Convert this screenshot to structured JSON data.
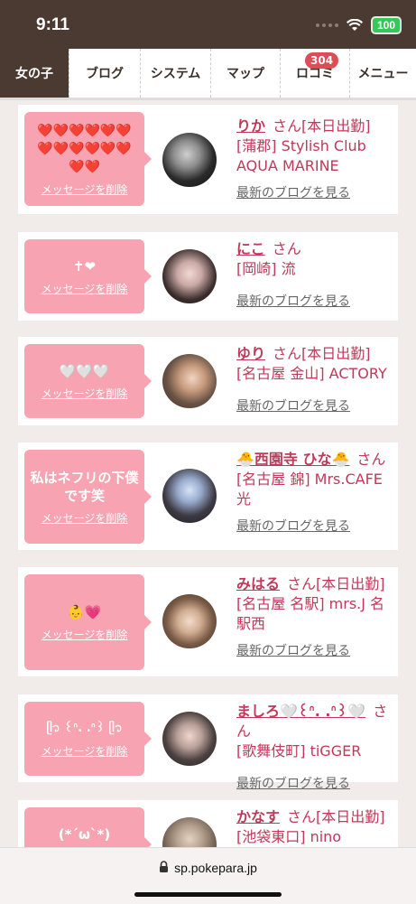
{
  "status": {
    "time": "9:11",
    "battery": "100"
  },
  "nav": {
    "tabs": [
      {
        "label": "女の子"
      },
      {
        "label": "ブログ"
      },
      {
        "label": "システム"
      },
      {
        "label": "マップ"
      },
      {
        "label": "ロコミ",
        "badge": "304"
      },
      {
        "label": "メニュー"
      }
    ]
  },
  "delete_label": "メッセージを削除",
  "san_label": "さん",
  "blog_label": "最新のブログを見る",
  "cards": [
    {
      "message": "❤️❤️❤️❤️❤️❤️❤️❤️❤️❤️❤️❤️❤️❤️",
      "name": "りか",
      "status": "[本日出勤]",
      "shop": "[蒲郡] Stylish Club AQUA MARINE"
    },
    {
      "message": "✝︎❤︎",
      "name": "にこ",
      "status": "",
      "shop": "[岡崎] 流"
    },
    {
      "message": "🤍🤍🤍",
      "name": "ゆり",
      "status": "[本日出勤]",
      "shop": "[名古屋 金山] ACTORY"
    },
    {
      "message": "私はネフリの下僕です笑",
      "name": "🐣西園寺 ひな🐣",
      "status": "",
      "shop": "[名古屋 錦] Mrs.CAFE 光"
    },
    {
      "message": "👶💗",
      "name": "みはる",
      "status": "[本日出勤]",
      "shop": "[名古屋 名駅] mrs.J 名駅西"
    },
    {
      "message": "ᥫ᭡ ꒰ᐢ. .ᐢ꒱ ᥫ᭡",
      "name": "ましろ🤍꒰ᐢ. .ᐢ꒱🤍",
      "status": "",
      "shop": "[歌舞伎町] tiGGER"
    },
    {
      "message": "(*´ω`*)",
      "name": "かなす",
      "status": "[本日出勤]",
      "shop": "[池袋東口] nino"
    }
  ],
  "url": "sp.pokepara.jp"
}
